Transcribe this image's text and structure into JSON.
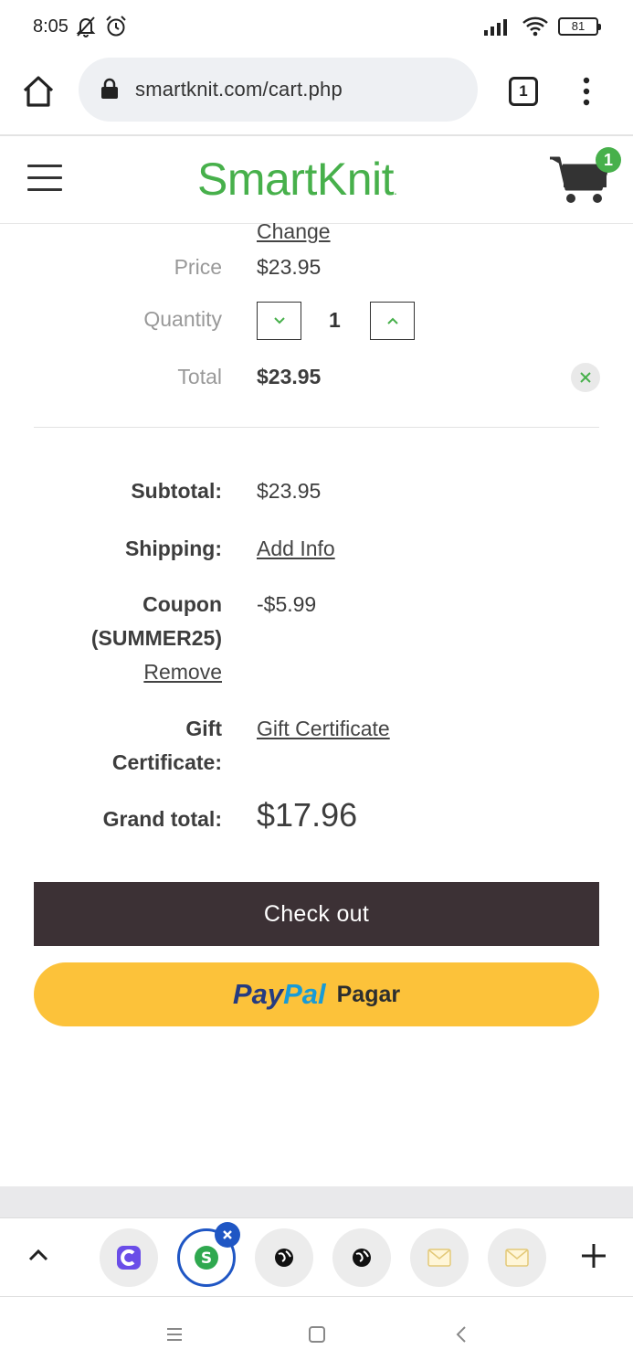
{
  "status_bar": {
    "time": "8:05",
    "battery": "81"
  },
  "browser": {
    "url": "smartknit.com/cart.php",
    "tab_count": "1"
  },
  "site": {
    "logo_text": "SmartKnit",
    "logo_mark": ".",
    "cart_count": "1"
  },
  "cart_item": {
    "change_label": "Change",
    "price_label": "Price",
    "price_value": "$23.95",
    "quantity_label": "Quantity",
    "quantity_value": "1",
    "total_label": "Total",
    "total_value": "$23.95"
  },
  "totals": {
    "subtotal_label": "Subtotal:",
    "subtotal_value": "$23.95",
    "shipping_label": "Shipping:",
    "shipping_link": "Add Info",
    "coupon_label": "Coupon",
    "coupon_code": "(SUMMER25)",
    "coupon_remove": "Remove",
    "coupon_value": "-$5.99",
    "gift_label_line1": "Gift",
    "gift_label_line2": "Certificate:",
    "gift_link": "Gift Certificate",
    "grand_label": "Grand total:",
    "grand_value": "$17.96"
  },
  "buttons": {
    "checkout": "Check out",
    "paypal_pay": "Pay",
    "paypal_pal": "Pal",
    "paypal_action": "Pagar"
  },
  "colors": {
    "brand_green": "#47b04b",
    "checkout_bg": "#3c3135",
    "paypal_yellow": "#fcc23a",
    "tab_active_blue": "#1f56c4"
  },
  "bottom_tabs": {
    "icons": [
      "chevron-up-icon",
      "c-app-icon",
      "s-app-icon",
      "globe-icon",
      "globe-icon",
      "mail-icon",
      "mail-icon",
      "plus-icon"
    ]
  }
}
